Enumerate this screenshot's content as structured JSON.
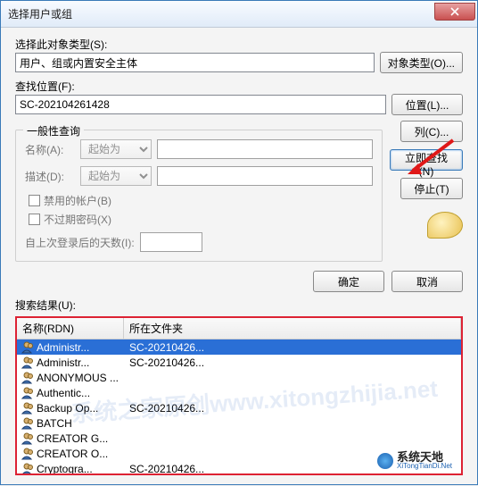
{
  "title": "选择用户或组",
  "object_type": {
    "label": "选择此对象类型(S):",
    "value": "用户、组或内置安全主体",
    "button": "对象类型(O)..."
  },
  "location": {
    "label": "查找位置(F):",
    "value": "SC-202104261428",
    "button": "位置(L)..."
  },
  "query_group": "一般性查询",
  "name": {
    "label": "名称(A):",
    "mode": "起始为"
  },
  "desc": {
    "label": "描述(D):",
    "mode": "起始为"
  },
  "disabled_accounts": "禁用的帐户(B)",
  "non_expiring": "不过期密码(X)",
  "days_since_logon": "自上次登录后的天数(I):",
  "buttons": {
    "columns": "列(C)...",
    "find_now": "立即查找(N)",
    "stop": "停止(T)",
    "ok": "确定",
    "cancel": "取消"
  },
  "results_label": "搜索结果(U):",
  "columns": {
    "name": "名称(RDN)",
    "folder": "所在文件夹"
  },
  "rows": [
    {
      "name": "Administr...",
      "folder": "SC-20210426...",
      "selected": true
    },
    {
      "name": "Administr...",
      "folder": "SC-20210426..."
    },
    {
      "name": "ANONYMOUS ...",
      "folder": ""
    },
    {
      "name": "Authentic...",
      "folder": ""
    },
    {
      "name": "Backup Op...",
      "folder": "SC-20210426..."
    },
    {
      "name": "BATCH",
      "folder": ""
    },
    {
      "name": "CREATOR G...",
      "folder": ""
    },
    {
      "name": "CREATOR O...",
      "folder": ""
    },
    {
      "name": "Cryptogra...",
      "folder": "SC-20210426..."
    }
  ],
  "watermark": "系统之家原创www.xitongzhijia.net",
  "badge": {
    "cn": "系统天地",
    "en": "XiTongTianDi.Net"
  }
}
